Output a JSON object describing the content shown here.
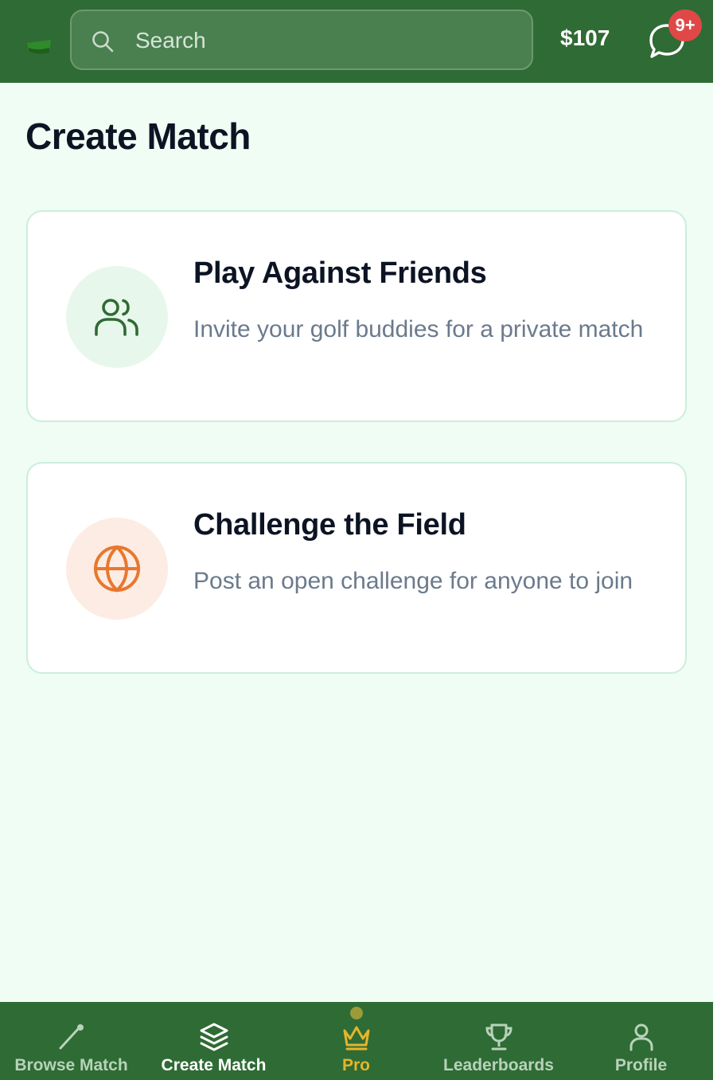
{
  "header": {
    "logo_icon": "golf-flag-logo",
    "search": {
      "placeholder": "Search",
      "value": ""
    },
    "balance": "$107",
    "messages": {
      "icon": "chat-bubble-icon",
      "badge": "9+"
    }
  },
  "page": {
    "title": "Create Match"
  },
  "options": [
    {
      "title": "Play Against Friends",
      "description": "Invite your golf buddies for a private match",
      "icon": "users-icon",
      "icon_color": "#2f6b34",
      "icon_bg": "#e8f7ec"
    },
    {
      "title": "Challenge the Field",
      "description": "Post an open challenge for anyone to join",
      "icon": "globe-icon",
      "icon_color": "#e8772e",
      "icon_bg": "#fdece3"
    }
  ],
  "bottom_nav": {
    "items": [
      {
        "label": "Browse Match",
        "icon": "golf-club-icon",
        "active": false
      },
      {
        "label": "Create Match",
        "icon": "layers-icon",
        "active": true
      },
      {
        "label": "Pro",
        "icon": "crown-icon",
        "active": false
      },
      {
        "label": "Leaderboards",
        "icon": "trophy-icon",
        "active": false
      },
      {
        "label": "Profile",
        "icon": "user-icon",
        "active": false
      }
    ]
  },
  "colors": {
    "brand": "#2f6b34",
    "background": "#f0fdf4",
    "badge": "#e04848",
    "pro": "#e5b52a"
  }
}
